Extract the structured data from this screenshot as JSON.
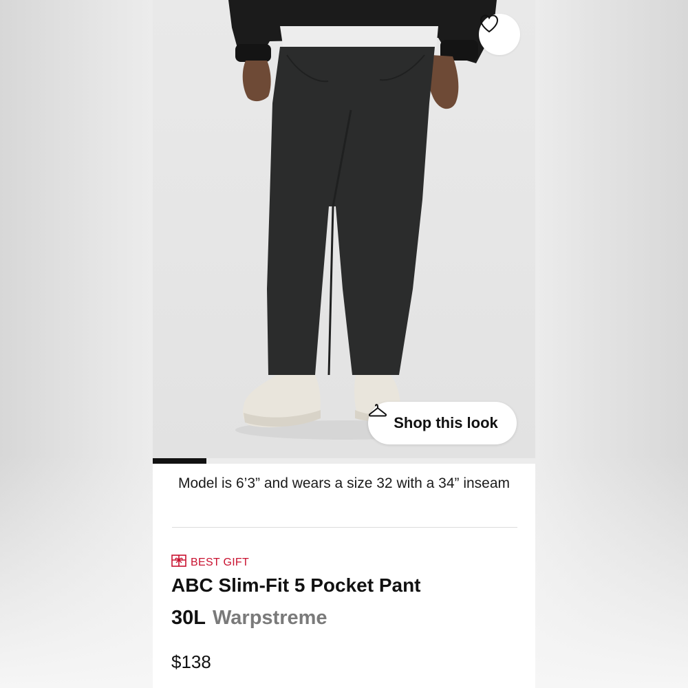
{
  "product": {
    "shop_look_label": "Shop this look",
    "gallery_progress": 0.14,
    "model_note": "Model is 6’3” and wears a size 32 with a 34” inseam",
    "badge": {
      "icon": "gift-icon",
      "label": "BEST GIFT",
      "color": "#c8102e"
    },
    "title": "ABC Slim-Fit 5 Pocket Pant",
    "size": "30L",
    "material": "Warpstreme",
    "price": "$138"
  },
  "icons": {
    "favorite": "heart-icon",
    "shop_look": "hanger-icon"
  },
  "colors": {
    "text": "#111111",
    "muted": "#7a7a7a",
    "badge_red": "#c8102e"
  }
}
